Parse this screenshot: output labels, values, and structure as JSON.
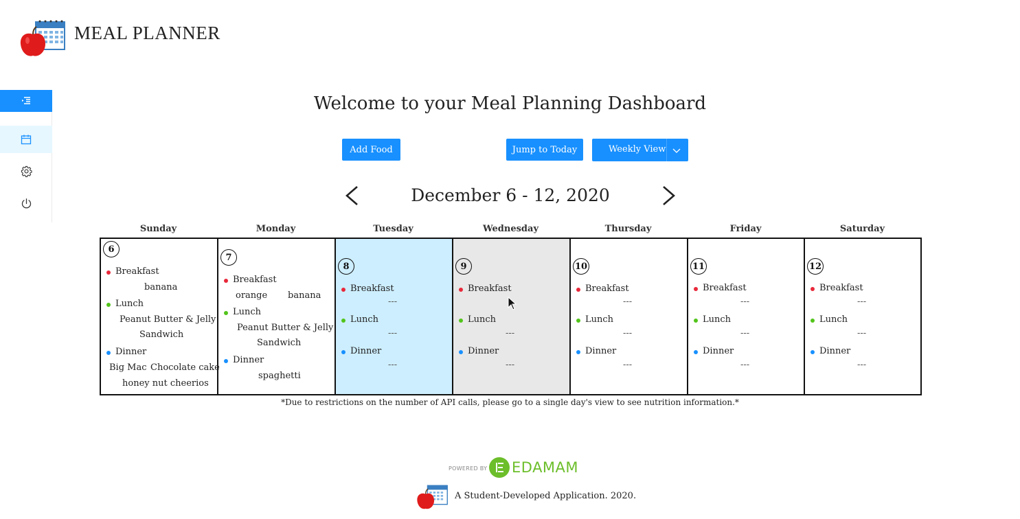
{
  "app": {
    "title": "MEAL PLANNER"
  },
  "sidebar": {
    "items": [
      {
        "name": "menu-unfold-icon"
      },
      {
        "name": "calendar-icon"
      },
      {
        "name": "gear-icon"
      },
      {
        "name": "power-icon"
      }
    ]
  },
  "main": {
    "welcome": "Welcome to your Meal Planning Dashboard",
    "add_food_label": "Add Food",
    "jump_today_label": "Jump to Today",
    "view_select_label": "Weekly View",
    "date_range": "December 6 - 12, 2020"
  },
  "calendar": {
    "days": [
      {
        "name": "Sunday",
        "num": "6",
        "breakfast_label": "Breakfast",
        "breakfast": [
          "banana"
        ],
        "lunch_label": "Lunch",
        "lunch": [
          "Peanut Butter & Jelly",
          "Sandwich"
        ],
        "dinner_label": "Dinner",
        "dinner": [
          "Big Mac",
          "Chocolate cake",
          "honey nut cheerios"
        ]
      },
      {
        "name": "Monday",
        "num": "7",
        "breakfast_label": "Breakfast",
        "breakfast": [
          "orange",
          "banana"
        ],
        "lunch_label": "Lunch",
        "lunch": [
          "Peanut Butter & Jelly",
          "Sandwich"
        ],
        "dinner_label": "Dinner",
        "dinner": [
          "spaghetti"
        ]
      },
      {
        "name": "Tuesday",
        "num": "8",
        "breakfast_label": "Breakfast",
        "lunch_label": "Lunch",
        "dinner_label": "Dinner",
        "empty": "---"
      },
      {
        "name": "Wednesday",
        "num": "9",
        "breakfast_label": "Breakfast",
        "lunch_label": "Lunch",
        "dinner_label": "Dinner",
        "empty": "---"
      },
      {
        "name": "Thursday",
        "num": "10",
        "breakfast_label": "Breakfast",
        "lunch_label": "Lunch",
        "dinner_label": "Dinner",
        "empty": "---"
      },
      {
        "name": "Friday",
        "num": "11",
        "breakfast_label": "Breakfast",
        "lunch_label": "Lunch",
        "dinner_label": "Dinner",
        "empty": "---"
      },
      {
        "name": "Saturday",
        "num": "12",
        "breakfast_label": "Breakfast",
        "lunch_label": "Lunch",
        "dinner_label": "Dinner",
        "empty": "---"
      }
    ],
    "colors": {
      "breakfast": "#e8283a",
      "lunch": "#52c41a",
      "dinner": "#1890ff",
      "today_bg": "#cdeefe",
      "hover_bg": "#e8e8e8"
    }
  },
  "note": "*Due to restrictions on the number of API calls, please go to a single day's view to see nutrition information.*",
  "footer": {
    "powered_by": "POWERED BY",
    "edamam": "EDAMAM",
    "credit": "A Student-Developed Application. 2020."
  }
}
